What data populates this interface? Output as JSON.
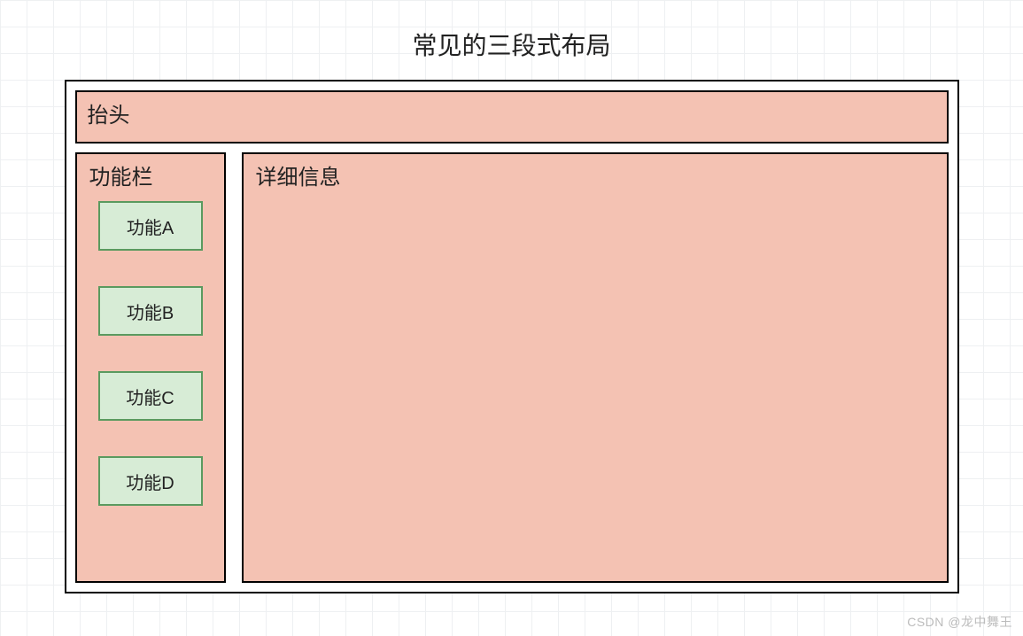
{
  "title": "常见的三段式布局",
  "header": {
    "label": "抬头"
  },
  "sidebar": {
    "title": "功能栏",
    "items": [
      {
        "label": "功能A"
      },
      {
        "label": "功能B"
      },
      {
        "label": "功能C"
      },
      {
        "label": "功能D"
      }
    ]
  },
  "detail": {
    "title": "详细信息"
  },
  "watermark": "CSDN @龙中舞王"
}
